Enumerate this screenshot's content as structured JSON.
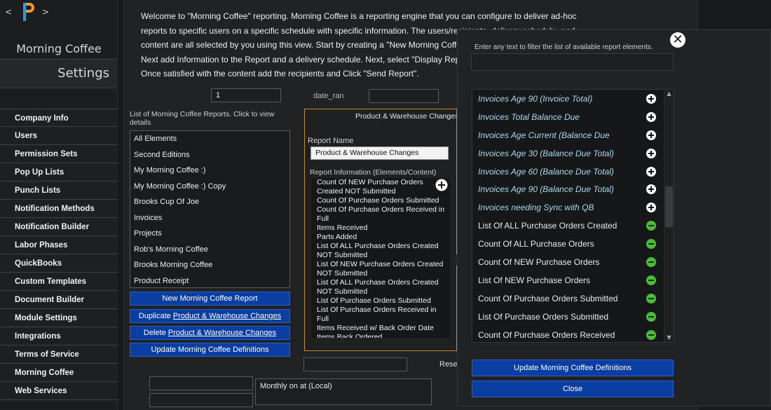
{
  "brand": {
    "prev_arrow": "<",
    "next_arrow": ">",
    "app_name": "Morning Coffee"
  },
  "settings": {
    "heading": "Settings",
    "menu": [
      "Company Info",
      "Users",
      "Permission Sets",
      "Pop Up Lists",
      "Punch Lists",
      "Notification Methods",
      "Notification Builder",
      "Labor Phases",
      "QuickBooks",
      "Custom Templates",
      "Document Builder",
      "Module Settings",
      "Integrations",
      "Terms of Service",
      "Morning Coffee",
      "Web Services"
    ]
  },
  "main": {
    "welcome_lines": [
      "Welcome to  \"Morning Coffee\" reporting.  Morning Coffee is a reporting engine that you can configure to deliver ad-hoc",
      "reports to specific users on a specific schedule with specific information.  The users/recipients, delivery schedule, and",
      "content are all selected by you using this view.  Start by creating a \"New Morning Coffee Report\".",
      "Next add Information to the Report and a delivery schedule.  Next, select \"Display Report\" to view the content.",
      "Once satisfied with the content add the recipients and Click \"Send Report\"."
    ],
    "report_count": "1",
    "date_ran_label": "date_ran",
    "reports_label": "List of Morning Coffee Reports.  Click to view details",
    "reports": [
      "All Elements",
      "Second Editions",
      "My Morning Coffee :)",
      "My Morning Coffee :) Copy",
      "Brooks Cup Of Joe",
      "Invoices",
      "Projects",
      "Rob's Morning Coffee",
      "Brooks Morning Coffee",
      "Product Receipt"
    ],
    "buttons": {
      "new_report": "New Morning Coffee Report",
      "duplicate_prefix": "Duplicate ",
      "duplicate_target": "Product & Warehouse Changes",
      "delete_prefix": "Delete ",
      "delete_target": "Product & Warehouse Changes",
      "update_definitions": "Update Morning Coffee Definitions"
    },
    "detail": {
      "title": "Product & Warehouse Changes",
      "report_name_label": "Report Name",
      "report_name_value": "Product & Warehouse Changes",
      "report_info_label": "Report Information (Elements/Content)",
      "info_lines": [
        "Count Of NEW Purchase Orders",
        "Created NOT Submitted",
        "Count Of Purchase Orders Submitted",
        "Count Of Purchase Orders Received in",
        "Full",
        "Items Received",
        "Parts Added",
        "List Of ALL Purchase Orders Created",
        "NOT Submitted",
        "List Of NEW Purchase Orders Created",
        "NOT Submitted",
        "List Of ALL Purchase Orders Created",
        "NOT Submitted",
        "List Of Purchase Orders Submitted",
        " List Of Purchase Orders Received in",
        "Full",
        "Items Received w/ Back Order Date",
        "Items Back Ordered"
      ]
    },
    "reset_label": "Reset",
    "schedule_text": "Monthly on  at  (Local)"
  },
  "modal": {
    "close_symbol": "✕",
    "filter_label": "Enter any text to filter the list of available report elements.",
    "filter_value": "",
    "elements": [
      {
        "label": "Invoices Age 90 (Invoice Total)",
        "state": "available"
      },
      {
        "label": "Invoices Total Balance Due",
        "state": "available"
      },
      {
        "label": "Invoices Age Current (Balance Due",
        "state": "available"
      },
      {
        "label": "Invoices Age 30 (Balance Due Total)",
        "state": "available"
      },
      {
        "label": "Invoices Age 60 (Balance Due Total)",
        "state": "available"
      },
      {
        "label": "Invoices Age 90 (Balance Due Total)",
        "state": "available"
      },
      {
        "label": "Invoices needing Sync with QB",
        "state": "available"
      },
      {
        "label": "List Of ALL Purchase Orders Created",
        "state": "added"
      },
      {
        "label": "Count Of ALL Purchase Orders",
        "state": "added"
      },
      {
        "label": "Count Of NEW Purchase Orders",
        "state": "added"
      },
      {
        "label": "List Of NEW Purchase Orders",
        "state": "added"
      },
      {
        "label": "Count Of Purchase Orders Submitted",
        "state": "added"
      },
      {
        "label": "List Of Purchase Orders Submitted",
        "state": "added"
      },
      {
        "label": "Count Of Purchase Orders Received",
        "state": "added"
      }
    ],
    "update_button": "Update Morning Coffee Definitions",
    "close_button": "Close"
  },
  "colors": {
    "accent_blue": "#0a3ea3",
    "panel_border_orange": "#c48a33",
    "available_text": "#a9d8ee",
    "added_icon_green": "#4bbd35"
  }
}
